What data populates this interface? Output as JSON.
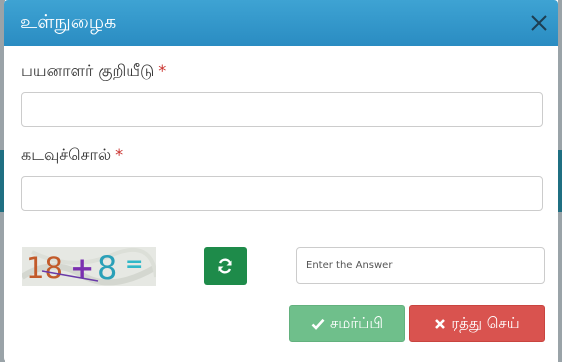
{
  "modal": {
    "title": "உள்நுழைக",
    "close_icon": "close-icon"
  },
  "form": {
    "username": {
      "label": "பயனாளர் குறியீடு",
      "required_mark": "*",
      "value": ""
    },
    "password": {
      "label": "கடவுச்சொல்",
      "required_mark": "*",
      "value": ""
    },
    "captcha": {
      "expression_left": "18",
      "operator": "+",
      "expression_right": "8",
      "equals": "=",
      "refresh_icon": "refresh-icon",
      "answer_placeholder": "Enter the Answer",
      "answer_value": ""
    }
  },
  "actions": {
    "submit_label": "சமர்ப்பி",
    "submit_icon": "check-icon",
    "cancel_label": "ரத்து செய்",
    "cancel_icon": "times-icon"
  },
  "colors": {
    "header": "#2a8cc2",
    "required": "#c9302c",
    "refresh": "#1e8b4a",
    "submit": "#6fbf8b",
    "cancel": "#d9534f"
  }
}
